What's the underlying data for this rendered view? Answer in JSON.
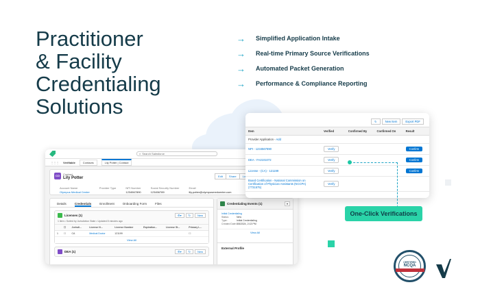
{
  "hero": {
    "title_lines": [
      "Practitioner",
      "& Facility",
      "Credentialing",
      "Solutions"
    ]
  },
  "features": [
    "Simplified Application Intake",
    "Real-time Primary Source Verifications",
    "Automated Packet Generation",
    "Performance & Compliance Reporting"
  ],
  "colors": {
    "accent": "#2ad3a8",
    "title": "#153b49",
    "arrow": "#1aa3c4",
    "sf_blue": "#0176d3"
  },
  "sf": {
    "search_placeholder": "Search Salesforce",
    "app_name": "Verifiable",
    "nav_tabs": [
      "Contacts",
      "Lily Potter | Contact"
    ],
    "contact_label": "Contact",
    "contact_name": "Lily Potter",
    "contact_initials": "CO",
    "actions": [
      "Edit",
      "Share",
      "Log in to Experience as User"
    ],
    "fields": [
      {
        "label": "Account Name",
        "value": "Olympus Medical Center",
        "link": true
      },
      {
        "label": "Provider Type",
        "value": "",
        "link": false
      },
      {
        "label": "NPI Number",
        "value": "1234567890",
        "link": false
      },
      {
        "label": "Social Security Number",
        "value": "123456789",
        "link": false
      },
      {
        "label": "Email",
        "value": "lily.potter@olympusmedcenter.com",
        "link": false
      }
    ],
    "tabs": [
      "Details",
      "Credentials",
      "Enrollment",
      "Onboarding Form",
      "Files"
    ],
    "licenses": {
      "title": "Licenses (1)",
      "sub": "1 item • Sorted by Jurisdiction State • Updated 8 minutes ago",
      "new_label": "New",
      "columns": [
        "Jurisdi...",
        "License N...",
        "License Number",
        "Expiration...",
        "License St...",
        "Primary L..."
      ],
      "row": [
        "1",
        "CA",
        "Medical Doctor",
        "121199",
        "",
        ""
      ],
      "view_all": "View All"
    },
    "dea": {
      "title": "DEA (1)",
      "new_label": "New"
    },
    "cred_events": {
      "title": "Credentialing Events (1)",
      "item_link": "Initial Credentialing",
      "rows": [
        {
          "k": "Status:",
          "v": "New"
        },
        {
          "k": "Type:",
          "v": "Initial Credentialing"
        },
        {
          "k": "Created Date:",
          "v": "8/8/2024, 2:13 PM"
        }
      ],
      "view_all": "View All"
    },
    "external_profile": "External Profile"
  },
  "verify_card": {
    "top_buttons": [
      "New Item",
      "Export PDF"
    ],
    "columns": [
      "Item",
      "Verified",
      "Confirmed By",
      "Confirmed On",
      "Result"
    ],
    "section_label": "Provider Application - ",
    "section_link": "Add",
    "rows": [
      {
        "item": "NPI - 1234567890",
        "verify": "Verify",
        "confirm": "Confirm"
      },
      {
        "item": "DEA - FA2101072",
        "verify": "Verify",
        "confirm": "Confirm"
      },
      {
        "item": "License - (CA) - 121199",
        "verify": "Verify",
        "confirm": "Confirm"
      },
      {
        "item": "Board Certification - National Commission on Certification of Physician Assistants (NCCPA) (7731575)",
        "verify": "Verify",
        "confirm": ""
      }
    ]
  },
  "callout": "One-Click Verifications",
  "seal": {
    "top": "CERTIFIED",
    "main": "NCQA",
    "bottom": "CREDENTIALS VERIFICATION ORGANIZATION"
  }
}
